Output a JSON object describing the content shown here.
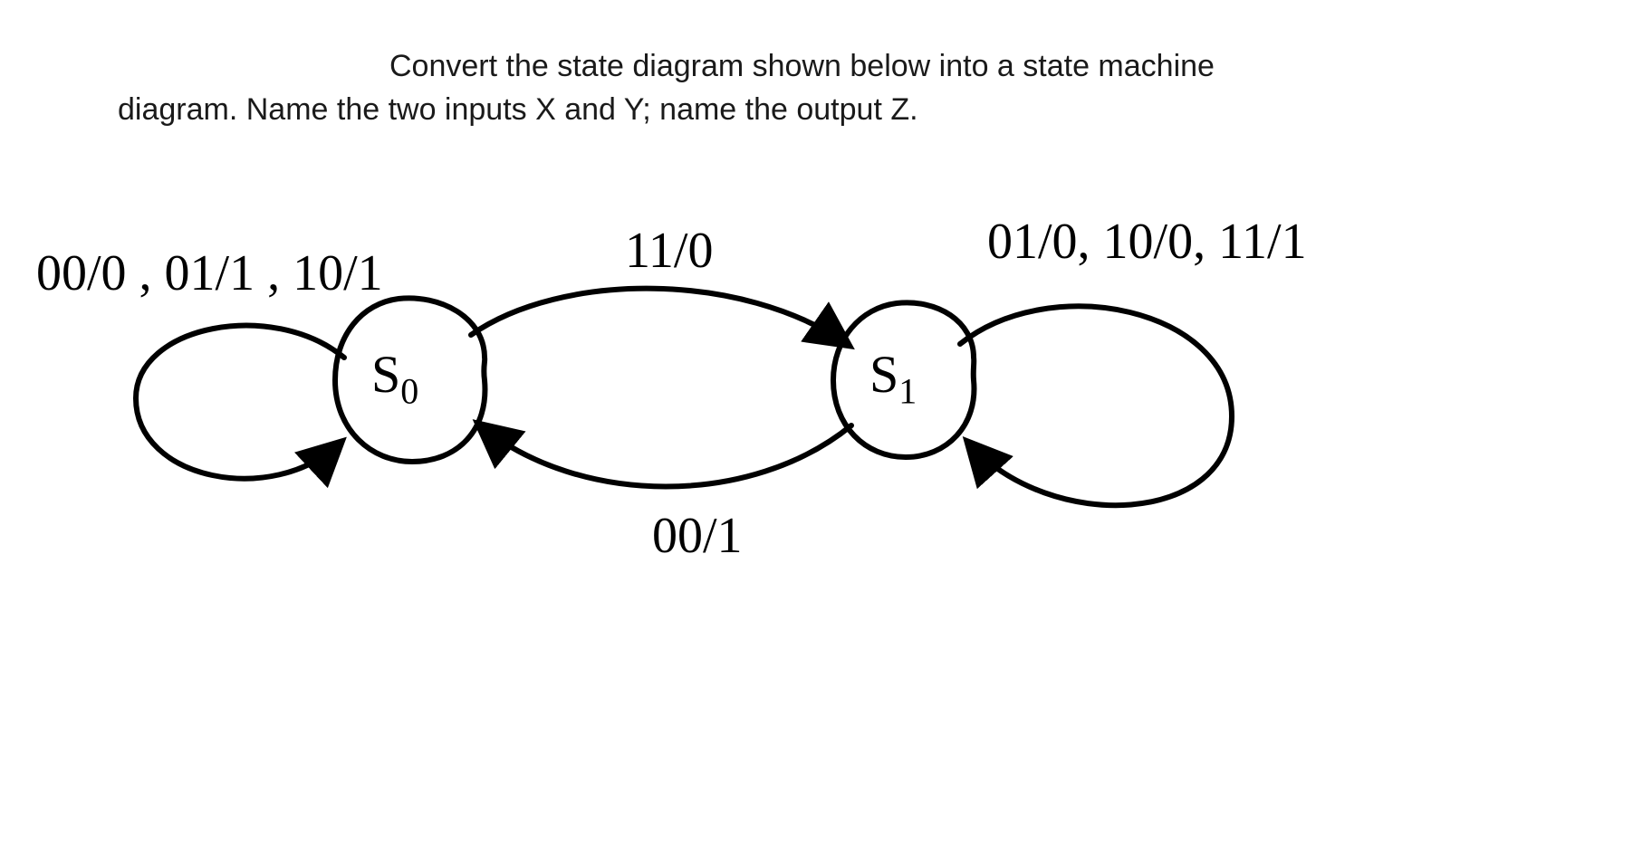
{
  "prompt_line1": "Convert the state diagram shown below into a state machine",
  "prompt_line2": "diagram. Name the two inputs X and Y; name the output  Z.",
  "states": {
    "s0": "S",
    "s0_sub": "0",
    "s1": "S",
    "s1_sub": "1"
  },
  "labels": {
    "s0_self": "00/0 , 01/1 , 10/1",
    "s0_to_s1": "11/0",
    "s1_to_s0": "00/1",
    "s1_self": "01/0, 10/0, 11/1"
  },
  "state_machine": {
    "inputs": [
      "X",
      "Y"
    ],
    "output": "Z",
    "transitions": [
      {
        "from": "S0",
        "input_XY": "00",
        "to": "S0",
        "Z": "0"
      },
      {
        "from": "S0",
        "input_XY": "01",
        "to": "S0",
        "Z": "1"
      },
      {
        "from": "S0",
        "input_XY": "10",
        "to": "S0",
        "Z": "1"
      },
      {
        "from": "S0",
        "input_XY": "11",
        "to": "S1",
        "Z": "0"
      },
      {
        "from": "S1",
        "input_XY": "00",
        "to": "S0",
        "Z": "1"
      },
      {
        "from": "S1",
        "input_XY": "01",
        "to": "S1",
        "Z": "0"
      },
      {
        "from": "S1",
        "input_XY": "10",
        "to": "S1",
        "Z": "0"
      },
      {
        "from": "S1",
        "input_XY": "11",
        "to": "S1",
        "Z": "1"
      }
    ]
  }
}
